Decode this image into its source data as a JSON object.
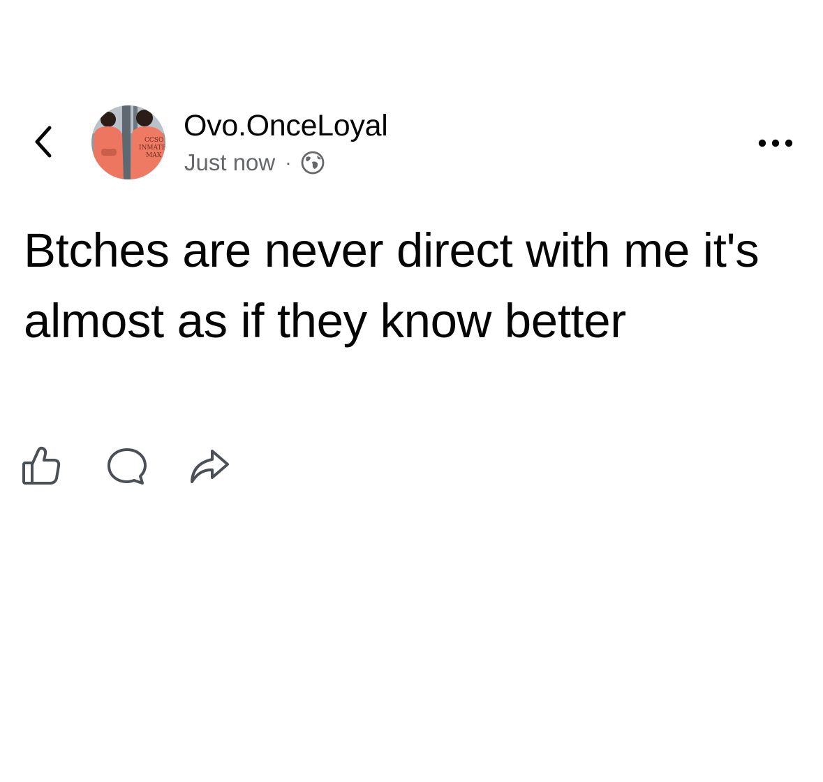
{
  "post": {
    "author": "Ovo.OnceLoyal",
    "timestamp": "Just now",
    "separator": "·",
    "privacy_icon": "globe-icon",
    "text": "Btches are never direct with me it's almost as if they know better",
    "avatar": {
      "shirt_text_line1": "CCSO",
      "shirt_text_line2": "INMATE",
      "shirt_text_line3": "MAX"
    }
  },
  "actions": {
    "like_icon": "thumbs-up-icon",
    "comment_icon": "comment-bubble-icon",
    "share_icon": "share-arrow-icon"
  },
  "colors": {
    "text_primary": "#050505",
    "text_secondary": "#65676b",
    "icon_gray": "#4b4f56",
    "background": "#ffffff"
  }
}
